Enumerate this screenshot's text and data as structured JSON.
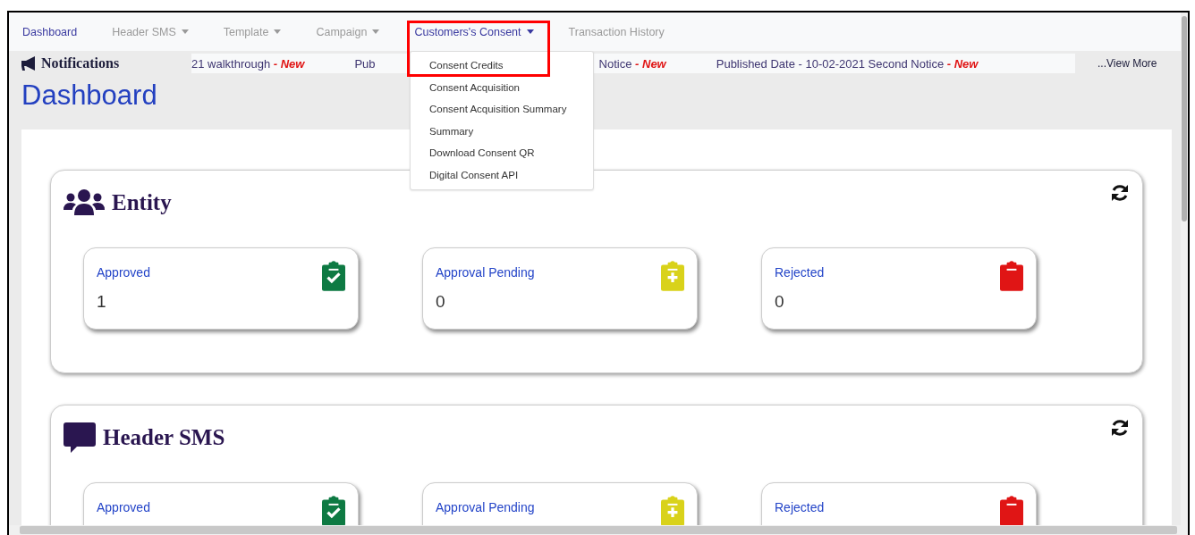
{
  "nav": {
    "items": [
      {
        "label": "Dashboard",
        "kind": "link",
        "active": true
      },
      {
        "label": "Header SMS",
        "kind": "dropdown",
        "active": false
      },
      {
        "label": "Template",
        "kind": "dropdown",
        "active": false
      },
      {
        "label": "Campaign",
        "kind": "dropdown",
        "active": false
      },
      {
        "label": "Customers's Consent",
        "kind": "dropdown",
        "active": true,
        "menu": [
          "Consent Credits",
          "Consent Acquisition",
          "Consent Acquisition Summary",
          "Summary",
          "Download Consent QR",
          "Digital Consent API"
        ]
      },
      {
        "label": "Transaction History",
        "kind": "link",
        "active": false
      }
    ]
  },
  "notifications": {
    "title": "Notifications",
    "items": [
      {
        "text": "21 walkthrough",
        "tag": "- New"
      },
      {
        "text": "Pub"
      },
      {
        "text": "Notice",
        "tag": "- New"
      },
      {
        "text": "Published Date - 10-02-2021 Second Notice",
        "tag": "- New"
      }
    ],
    "more": "...View More"
  },
  "page_title": "Dashboard",
  "sections": [
    {
      "title": "Entity",
      "kind": "users",
      "stats": [
        {
          "label": "Approved",
          "value": "1",
          "kind": "check",
          "color": "#0e7a43"
        },
        {
          "label": "Approval Pending",
          "value": "0",
          "kind": "plus",
          "color": "#d9d21a"
        },
        {
          "label": "Rejected",
          "value": "0",
          "kind": "plain",
          "color": "#e01515"
        }
      ]
    },
    {
      "title": "Header SMS",
      "kind": "comment",
      "stats": [
        {
          "label": "Approved",
          "kind": "check",
          "color": "#0e7a43"
        },
        {
          "label": "Approval Pending",
          "kind": "plus",
          "color": "#d9d21a"
        },
        {
          "label": "Rejected",
          "kind": "plain",
          "color": "#e01515"
        }
      ]
    }
  ]
}
